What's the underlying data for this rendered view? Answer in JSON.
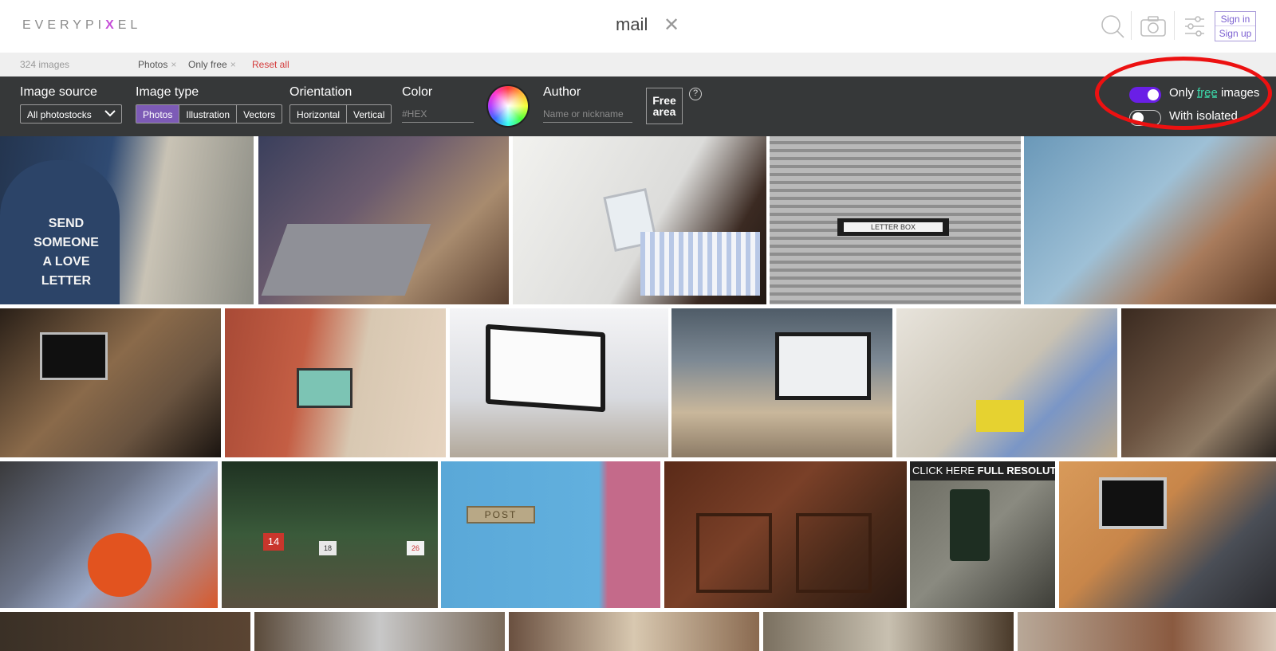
{
  "header": {
    "logo_pre": "EVERYPI",
    "logo_x": "X",
    "logo_post": "EL",
    "query": "mail",
    "clear_icon": "close-icon",
    "icons": [
      "search-icon",
      "camera-icon",
      "settings-sliders-icon"
    ],
    "sign_in": "Sign in",
    "sign_up": "Sign up"
  },
  "strip": {
    "count": "324 images",
    "chips": [
      "Photos",
      "Only free"
    ],
    "chip_close": "×",
    "reset": "Reset all"
  },
  "filters": {
    "image_source": {
      "label": "Image source",
      "value": "All photostocks"
    },
    "image_type": {
      "label": "Image type",
      "options": [
        "Photos",
        "Illustration",
        "Vectors"
      ],
      "selected": "Photos"
    },
    "orientation": {
      "label": "Orientation",
      "options": [
        "Horizontal",
        "Vertical"
      ]
    },
    "color": {
      "label": "Color",
      "placeholder": "#HEX"
    },
    "author": {
      "label": "Author",
      "placeholder": "Name or nickname"
    },
    "free_area": {
      "line1": "Free",
      "line2": "area",
      "help": "?"
    },
    "only_free": {
      "pre": "Only ",
      "free": "free",
      "post": " images",
      "on": true
    },
    "with_isolated": {
      "label": "With isolated",
      "on": false
    }
  },
  "colors": {
    "accent": "#6a1fe6",
    "filter_bg": "#363839",
    "active_seg": "#7d5bb6",
    "reset": "#d43b3b",
    "annotation": "#ec1111"
  },
  "tile_texts": {
    "send": [
      "SEND",
      "SOMEONE",
      "A LOVE",
      "LETTER"
    ],
    "letterbox": "LETTER  BOX",
    "post": "POST",
    "mailbox_nums": [
      "14",
      "18",
      "26"
    ],
    "click_here": "CLICK HERE ",
    "full_res": "FULL RESOLUTION"
  }
}
